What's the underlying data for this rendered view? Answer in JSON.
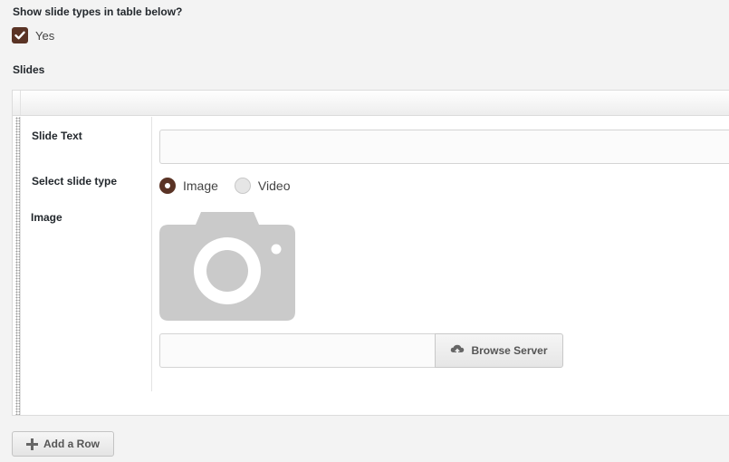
{
  "show_types": {
    "question": "Show slide types in table below?",
    "checkbox_label": "Yes",
    "checked": true
  },
  "slides": {
    "section_label": "Slides",
    "row": {
      "slide_text_label": "Slide Text",
      "slide_text_value": "",
      "slide_type_label": "Select slide type",
      "slide_type_options": [
        "Image",
        "Video"
      ],
      "slide_type_selected": "Image",
      "image_label": "Image",
      "image_placeholder_icon": "camera-icon",
      "image_path_value": "",
      "browse_label": "Browse Server",
      "browse_icon": "upload-cloud-icon"
    }
  },
  "add_row": {
    "label": "Add a Row",
    "icon": "plus-icon"
  },
  "colors": {
    "accent": "#5a3325",
    "background": "#f3f3f3",
    "placeholder_gray": "#cacaca"
  }
}
